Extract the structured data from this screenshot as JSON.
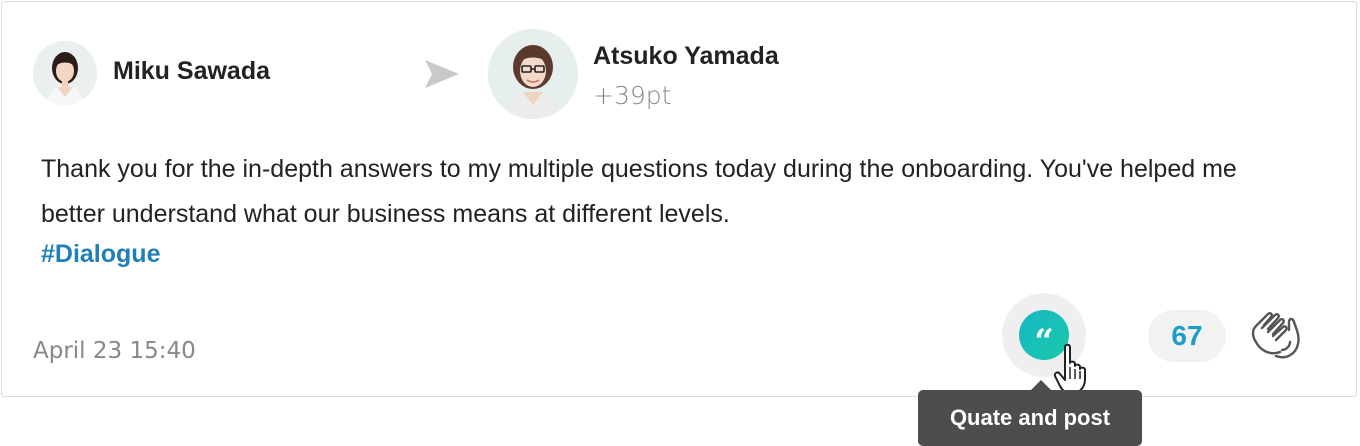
{
  "post": {
    "sender": {
      "name": "Miku Sawada"
    },
    "recipient": {
      "name": "Atsuko Yamada",
      "points": "+39pt"
    },
    "message": "Thank you for the in-depth answers to my multiple questions today during the onboarding. You've helped me better understand what our business means at different levels.",
    "hashtag": "#Dialogue",
    "timestamp": "April 23 15:40"
  },
  "actions": {
    "quote_icon": "quote-icon",
    "clap_count": "67",
    "clap_icon": "clapping-hands-icon",
    "tooltip": "Quate and post"
  },
  "colors": {
    "hashtag": "#1f7fb6",
    "quote_gradient_start": "#17b7c5",
    "quote_gradient_end": "#19c9a8",
    "clap_count": "#1a9ec8",
    "tooltip_bg": "#4d4d4d"
  }
}
